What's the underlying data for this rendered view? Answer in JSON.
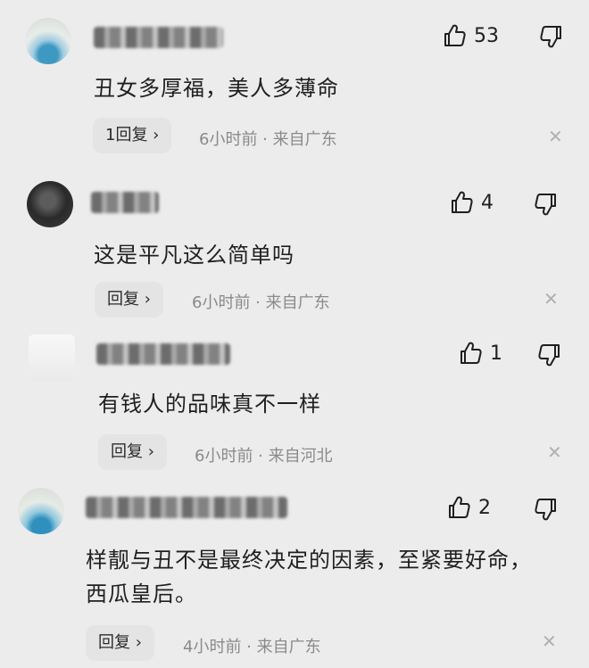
{
  "comments": [
    {
      "likes": "53",
      "text": "丑女多厚福，美人多薄命",
      "reply": "1回复 ›",
      "meta": "6小时前 · 来自广东"
    },
    {
      "likes": "4",
      "text": "这是平凡这么简单吗",
      "reply": "回复 ›",
      "meta": "6小时前 · 来自广东"
    },
    {
      "likes": "1",
      "text": "有钱人的品味真不一样",
      "reply": "回复 ›",
      "meta": "6小时前 · 来自河北"
    },
    {
      "likes": "2",
      "text": "样靓与丑不是最终决定的因素，至紧要好命，西瓜皇后。",
      "reply": "回复 ›",
      "meta": "4小时前 · 来自广东"
    }
  ],
  "icons": {
    "like": "thumbs-up-icon",
    "dislike": "thumbs-down-icon",
    "close": "close-icon"
  },
  "colors": {
    "background": "#ececec",
    "meta_text": "#8a8a8a"
  }
}
